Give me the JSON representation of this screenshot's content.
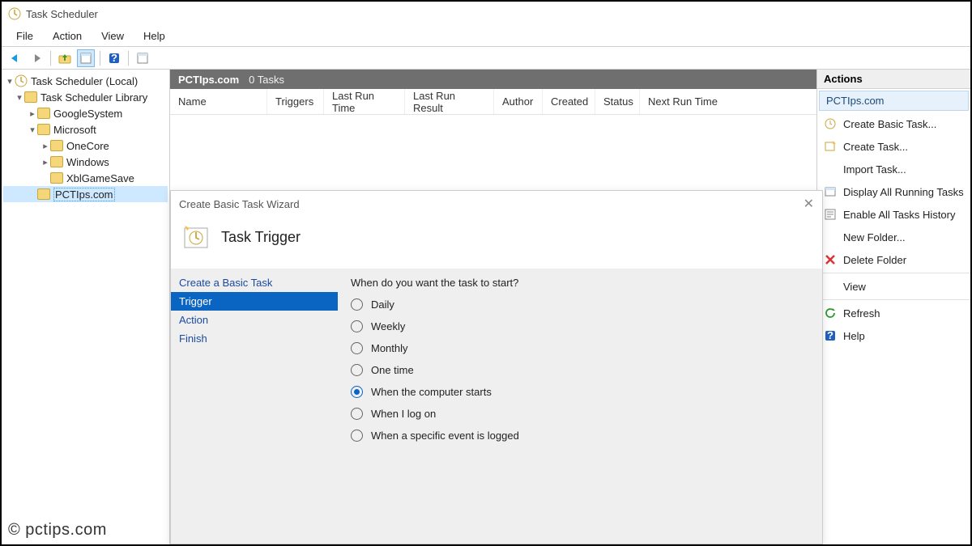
{
  "window_title": "Task Scheduler",
  "menu": {
    "file": "File",
    "action": "Action",
    "view": "View",
    "help": "Help"
  },
  "tree": {
    "root": "Task Scheduler (Local)",
    "library": "Task Scheduler Library",
    "items": [
      {
        "label": "GoogleSystem"
      },
      {
        "label": "Microsoft"
      },
      {
        "label": "OneCore"
      },
      {
        "label": "Windows"
      },
      {
        "label": "XblGameSave"
      },
      {
        "label": "PCTIps.com"
      }
    ]
  },
  "center": {
    "header_path": "PCTIps.com",
    "header_count": "0 Tasks",
    "columns": [
      "Name",
      "Triggers",
      "Last Run Time",
      "Last Run Result",
      "Author",
      "Created",
      "Status",
      "Next Run Time"
    ]
  },
  "actions_title": "Actions",
  "actions_section": "PCTIps.com",
  "actions": [
    {
      "label": "Create Basic Task..."
    },
    {
      "label": "Create Task..."
    },
    {
      "label": "Import Task..."
    },
    {
      "label": "Display All Running Tasks"
    },
    {
      "label": "Enable All Tasks History"
    },
    {
      "label": "New Folder..."
    },
    {
      "label": "Delete Folder"
    },
    {
      "label": "View"
    },
    {
      "label": "Refresh"
    },
    {
      "label": "Help"
    }
  ],
  "wizard": {
    "window_title": "Create Basic Task Wizard",
    "banner_title": "Task Trigger",
    "steps": [
      "Create a Basic Task",
      "Trigger",
      "Action",
      "Finish"
    ],
    "active_step": "Trigger",
    "question": "When do you want the task to start?",
    "options": [
      "Daily",
      "Weekly",
      "Monthly",
      "One time",
      "When the computer starts",
      "When I log on",
      "When a specific event is logged"
    ],
    "selected_option": "When the computer starts"
  },
  "watermark": "© pctips.com"
}
